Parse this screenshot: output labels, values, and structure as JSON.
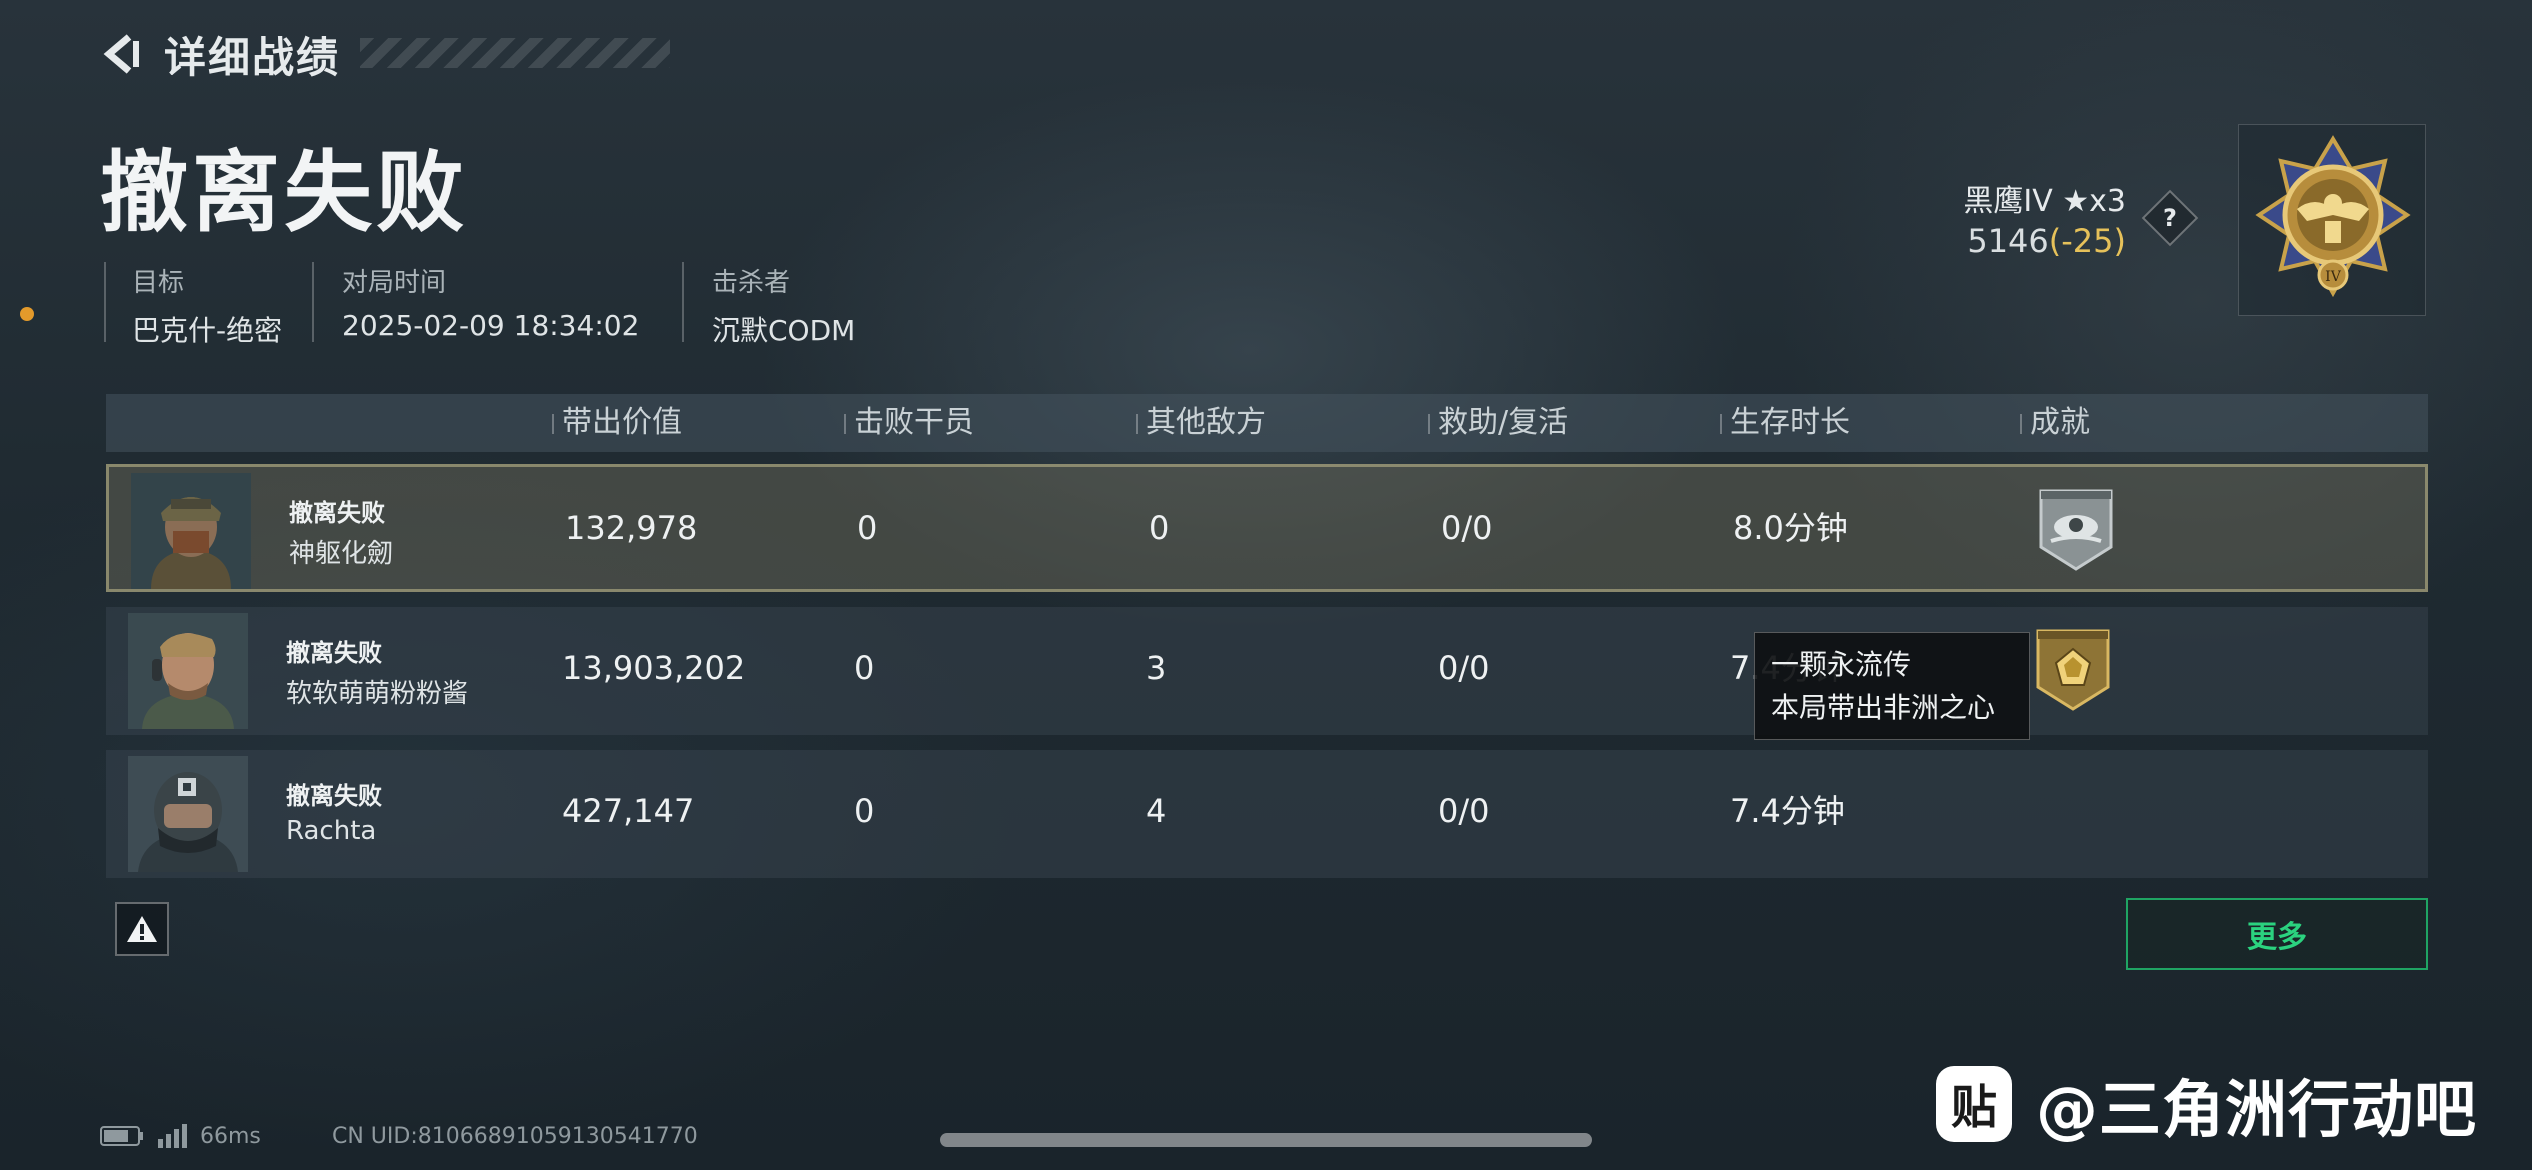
{
  "header": {
    "title": "详细战绩"
  },
  "result": {
    "title": "撤离失败"
  },
  "meta": [
    {
      "label": "目标",
      "value": "巴克什-绝密"
    },
    {
      "label": "对局时间",
      "value": "2025-02-09 18:34:02"
    },
    {
      "label": "击杀者",
      "value": "沉默CODM"
    }
  ],
  "rank": {
    "name": "黑鹰IV ★x3",
    "score": "5146",
    "delta": "(-25)",
    "help": "?"
  },
  "table": {
    "headers": [
      "带出价值",
      "击败干员",
      "其他敌方",
      "救助/复活",
      "生存时长",
      "成就"
    ],
    "rows": [
      {
        "status": "撤离失败",
        "name": "神躯化劒",
        "value": "132,978",
        "kills": "0",
        "others": "0",
        "assist": "0/0",
        "time": "8.0分钟"
      },
      {
        "status": "撤离失败",
        "name": "软软萌萌粉粉酱",
        "value": "13,903,202",
        "kills": "0",
        "others": "3",
        "assist": "0/0",
        "time": "7.4分钟"
      },
      {
        "status": "撤离失败",
        "name": "Rachta",
        "value": "427,147",
        "kills": "0",
        "others": "4",
        "assist": "0/0",
        "time": "7.4分钟"
      }
    ]
  },
  "tooltip": {
    "line1": "一颗永流传",
    "line2": "本局带出非洲之心"
  },
  "more_label": "更多",
  "footer": {
    "ping": "66ms",
    "uid": "CN UID:81066891059130541770"
  },
  "watermark": {
    "logo": "贴",
    "text": "@三角洲行动吧"
  },
  "colors": {
    "accent_green": "#2bd27f",
    "delta_gold": "#e6c15a",
    "orange_dot": "#e39a2b"
  }
}
